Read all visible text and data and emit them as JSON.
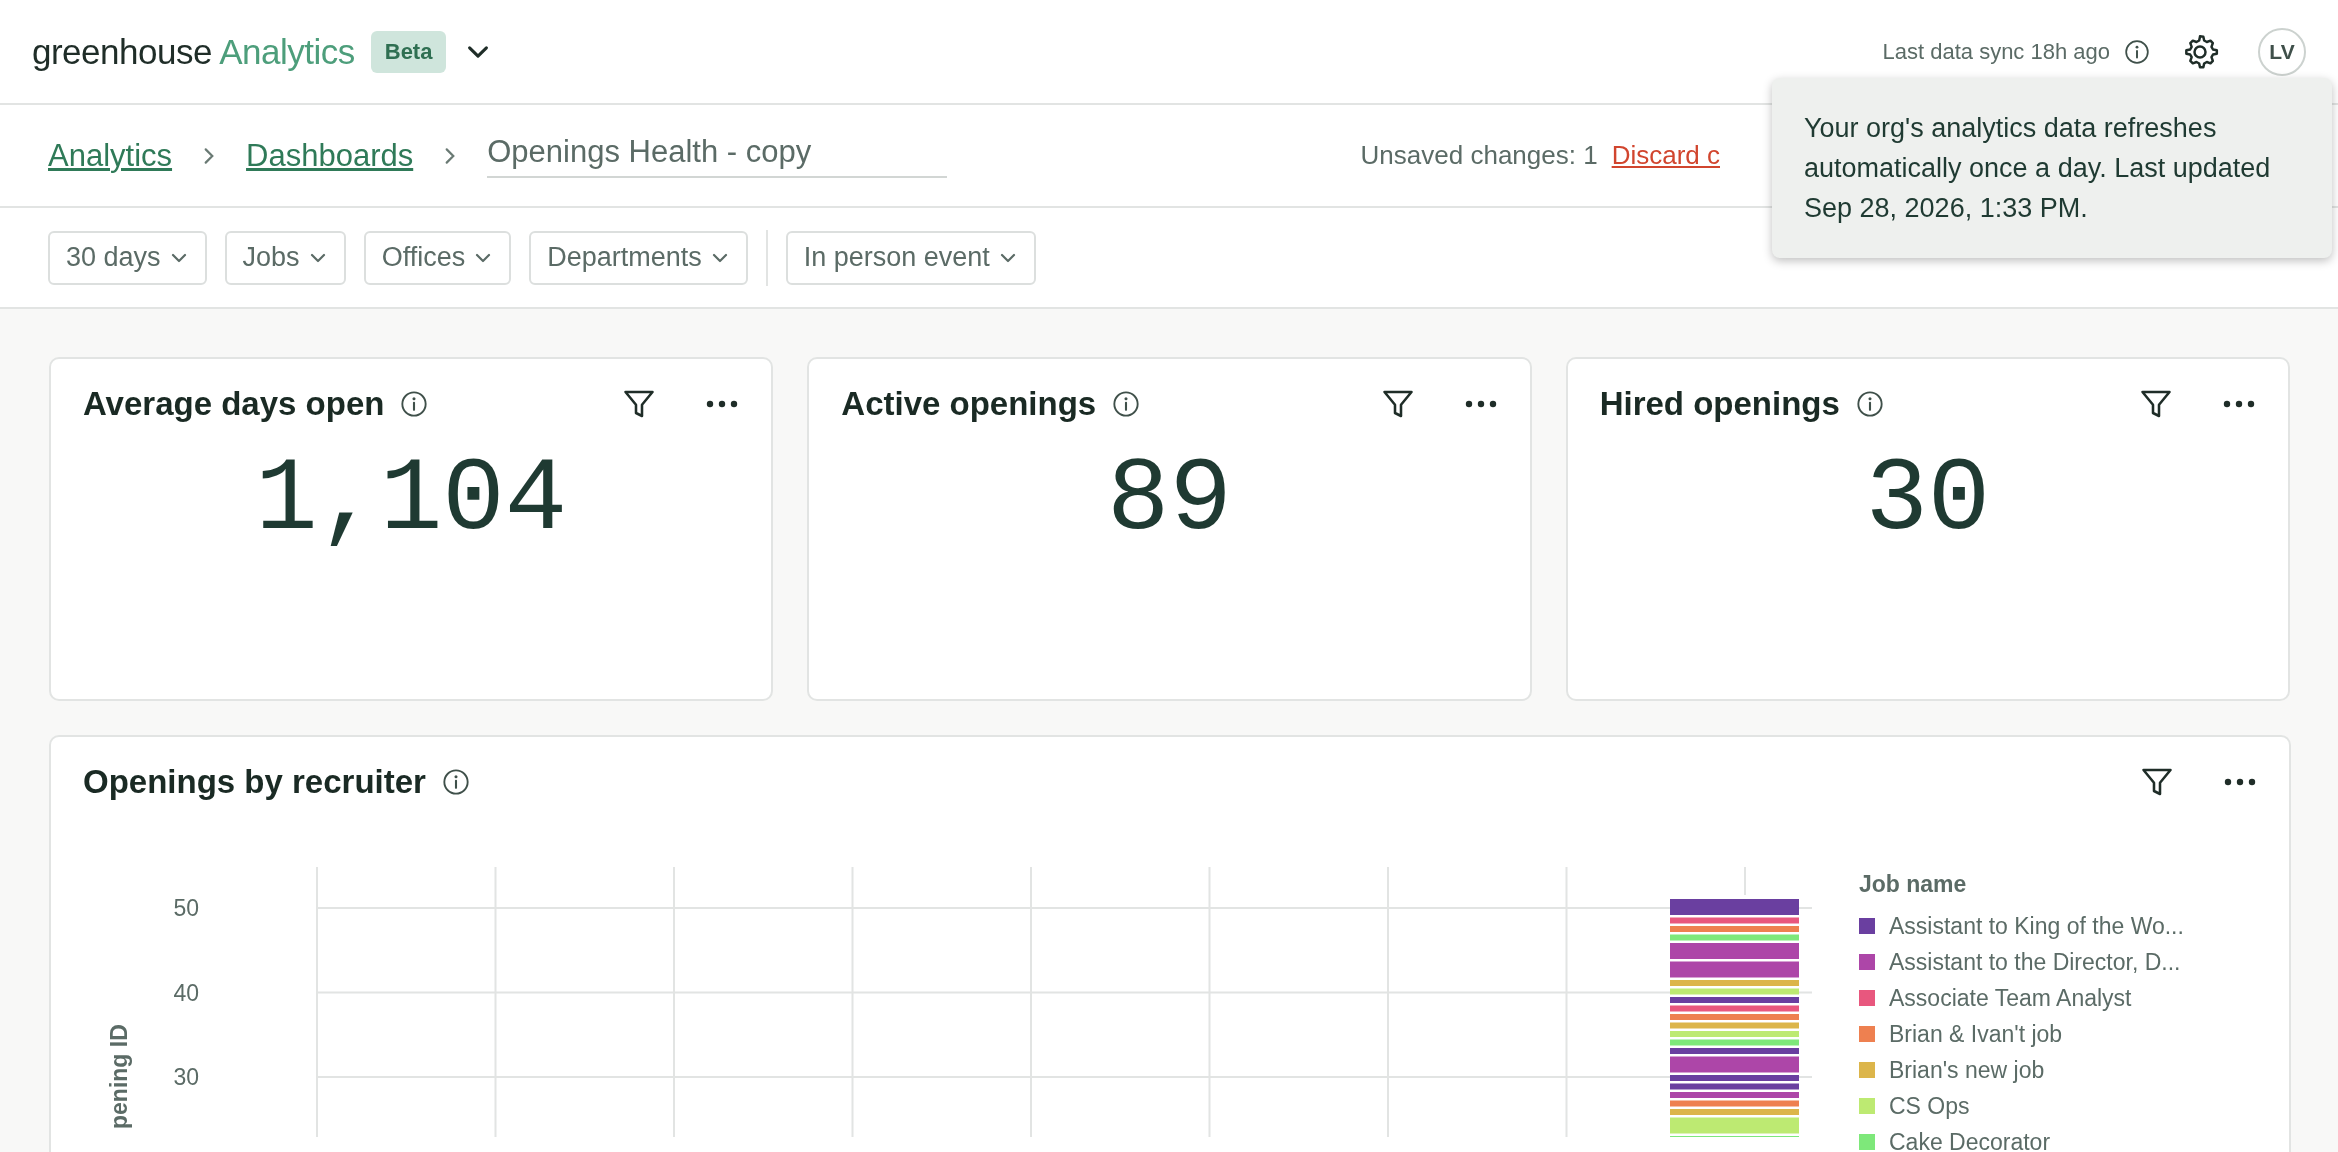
{
  "header": {
    "brand": "greenhouse",
    "product": "Analytics",
    "badge": "Beta",
    "sync_text": "Last data sync 18h ago",
    "avatar": "LV"
  },
  "tooltip": {
    "text": "Your org's analytics data refreshes automatically once a day. Last updated Sep 28, 2026, 1:33 PM."
  },
  "breadcrumb": {
    "links": [
      "Analytics",
      "Dashboards"
    ],
    "title": "Openings Health - copy"
  },
  "unsaved": {
    "label": "Unsaved changes: 1",
    "discard": "Discard c"
  },
  "filter_groups": [
    {
      "filters": [
        "30 days",
        "Jobs",
        "Offices",
        "Departments"
      ]
    },
    {
      "filters": [
        "In person event"
      ]
    }
  ],
  "metrics": [
    {
      "title": "Average days open",
      "value": "1,104"
    },
    {
      "title": "Active openings",
      "value": "89"
    },
    {
      "title": "Hired openings",
      "value": "30"
    }
  ],
  "chart_card": {
    "title": "Openings by recruiter",
    "y_axis_label": "pening ID",
    "y_ticks": [
      "50",
      "40",
      "30"
    ],
    "legend_title": "Job name",
    "legend": [
      {
        "label": "Assistant to King of the Wo...",
        "color": "#6a3fa0"
      },
      {
        "label": "Assistant to the Director, D...",
        "color": "#ad46a8"
      },
      {
        "label": "Associate Team Analyst",
        "color": "#e8577e"
      },
      {
        "label": "Brian & Ivan't job",
        "color": "#ee8050"
      },
      {
        "label": "Brian's new job",
        "color": "#dcb54a"
      },
      {
        "label": "CS Ops",
        "color": "#bdea72"
      },
      {
        "label": "Cake Decorator",
        "color": "#7ee87a"
      }
    ]
  }
}
